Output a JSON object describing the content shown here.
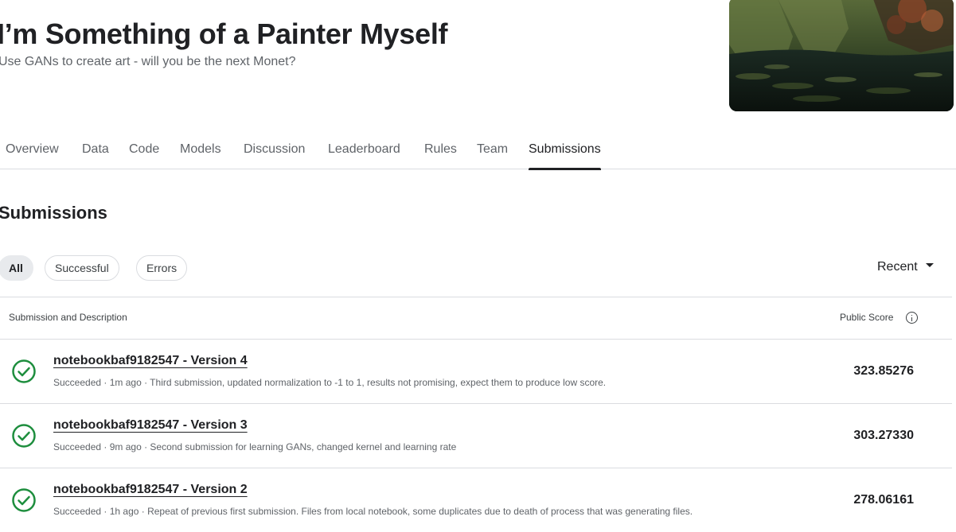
{
  "competition": {
    "title": "I’m Something of a Painter Myself",
    "subtitle": "Use GANs to create art - will you be the next Monet?"
  },
  "tabs": [
    {
      "label": "Overview"
    },
    {
      "label": "Data"
    },
    {
      "label": "Code"
    },
    {
      "label": "Models"
    },
    {
      "label": "Discussion"
    },
    {
      "label": "Leaderboard"
    },
    {
      "label": "Rules"
    },
    {
      "label": "Team"
    },
    {
      "label": "Submissions",
      "active": true
    }
  ],
  "section_title": "Submissions",
  "filters": [
    {
      "label": "All",
      "selected": true
    },
    {
      "label": "Successful"
    },
    {
      "label": "Errors"
    }
  ],
  "sort": {
    "label": "Recent"
  },
  "table": {
    "col_left": "Submission and Description",
    "col_right": "Public Score"
  },
  "submissions": [
    {
      "title": "notebookbaf9182547 - Version 4",
      "meta": "Succeeded · 1m ago · Third submission, updated normalization to -1 to 1, results not promising, expect them to produce low score.",
      "score": "323.85276"
    },
    {
      "title": "notebookbaf9182547 - Version 3",
      "meta": "Succeeded · 9m ago · Second submission for learning GANs, changed kernel and learning rate",
      "score": "303.27330"
    },
    {
      "title": "notebookbaf9182547 - Version 2",
      "meta": "Succeeded · 1h ago · Repeat of previous first submission. Files from local notebook, some duplicates due to death of process that was generating files.",
      "score": "278.06161"
    }
  ],
  "colors": {
    "success": "#1e8e3e",
    "text": "#202124",
    "muted": "#5f6368",
    "border": "#dadce0"
  },
  "icons": {
    "status": "check-circle-icon",
    "info": "info-icon",
    "sort": "caret-down-icon"
  }
}
